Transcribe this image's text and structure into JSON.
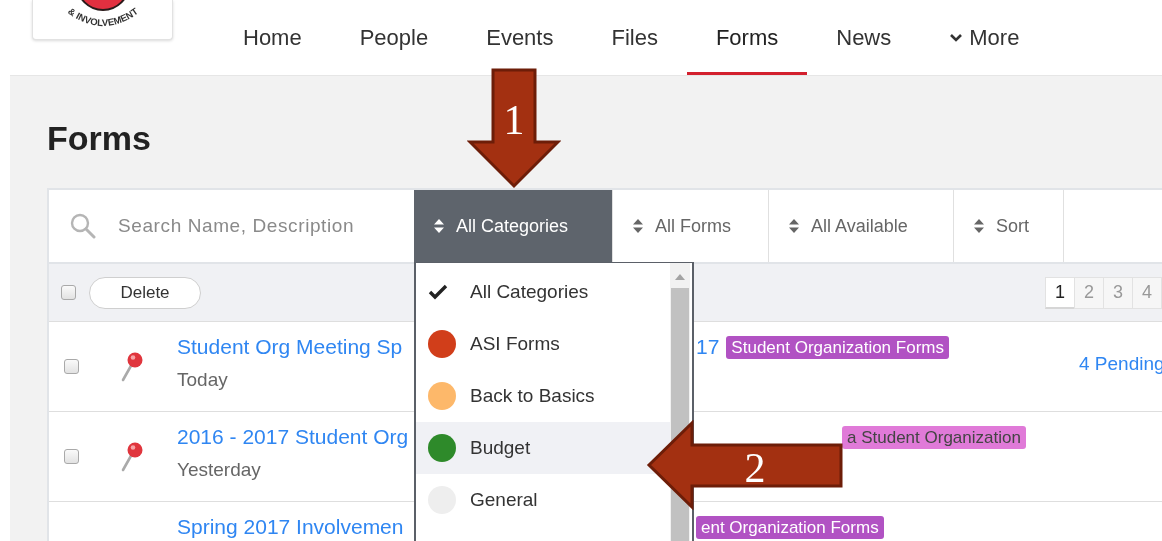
{
  "logo": {
    "caption": "& INVOLVEMENT"
  },
  "nav": [
    {
      "label": "Home",
      "selected": false
    },
    {
      "label": "People",
      "selected": false
    },
    {
      "label": "Events",
      "selected": false
    },
    {
      "label": "Files",
      "selected": false
    },
    {
      "label": "Forms",
      "selected": true
    },
    {
      "label": "News",
      "selected": false
    },
    {
      "label": "More",
      "selected": false,
      "kind": "menu"
    }
  ],
  "page_title": "Forms",
  "search": {
    "placeholder": "Search Name, Description"
  },
  "filters": [
    {
      "label": "All Categories",
      "open": true
    },
    {
      "label": "All Forms",
      "open": false
    },
    {
      "label": "All Available",
      "open": false
    },
    {
      "label": "Sort",
      "open": false
    }
  ],
  "actions": {
    "select_all_checked": false,
    "delete_label": "Delete"
  },
  "pagination": [
    {
      "label": "1",
      "selected": true
    },
    {
      "label": "2",
      "selected": false
    },
    {
      "label": "3",
      "selected": false
    },
    {
      "label": "4",
      "selected": false
    }
  ],
  "rows": [
    {
      "checked": false,
      "pinned": true,
      "title": "Student Org Meeting Sp",
      "title_end": "17",
      "tag": {
        "label": "Student Organization Forms",
        "color": "#b152c3"
      },
      "date": "Today",
      "status": "4 Pending"
    },
    {
      "checked": false,
      "pinned": true,
      "title": "2016 - 2017 Student Org",
      "tag": {
        "label": "a Student Organization",
        "color": "#e07ad8"
      },
      "date": "Yesterday"
    },
    {
      "title": "Spring 2017 Involvemen",
      "tag": {
        "label": "ent Organization Forms",
        "color": "#b152c3"
      }
    }
  ],
  "category_menu": {
    "items": [
      {
        "label": "All Categories",
        "kind": "all",
        "selected": true,
        "highlighted": false
      },
      {
        "label": "ASI Forms",
        "kind": "category",
        "color": "#d13e1a",
        "selected": false,
        "highlighted": false
      },
      {
        "label": "Back to Basics",
        "kind": "category",
        "color": "#fdb86a",
        "selected": false,
        "highlighted": false
      },
      {
        "label": "Budget",
        "kind": "category",
        "color": "#2e8a2a",
        "selected": false,
        "highlighted": true
      },
      {
        "label": "General",
        "kind": "category",
        "color": "#eeeeee",
        "selected": false,
        "highlighted": false
      }
    ]
  },
  "callouts": [
    {
      "number": "1",
      "kind": "down"
    },
    {
      "number": "2",
      "kind": "left"
    }
  ]
}
